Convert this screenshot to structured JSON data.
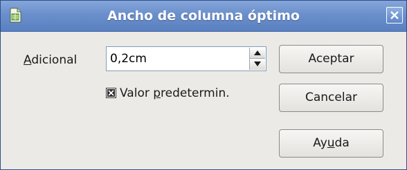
{
  "window": {
    "title": "Ancho de columna óptimo",
    "app_icon": "calc-spreadsheet-icon",
    "close_icon": "close-icon"
  },
  "form": {
    "adicional_label_accel": "A",
    "adicional_label_rest": "dicional",
    "adicional_value": "0,2cm",
    "spin_up_icon": "arrow-up-icon",
    "spin_down_icon": "arrow-down-icon",
    "default_checkbox": {
      "checked": true,
      "label_pre": "Valor ",
      "label_accel": "p",
      "label_rest": "redetermin."
    }
  },
  "buttons": {
    "ok_label": "Aceptar",
    "cancel_label": "Cancelar",
    "help_label_pre": "Ay",
    "help_label_accel": "u",
    "help_label_rest": "da"
  },
  "colors": {
    "titlebar": "#6a8fcc",
    "dialog_bg": "#eceae6",
    "border": "#2a4f88"
  }
}
